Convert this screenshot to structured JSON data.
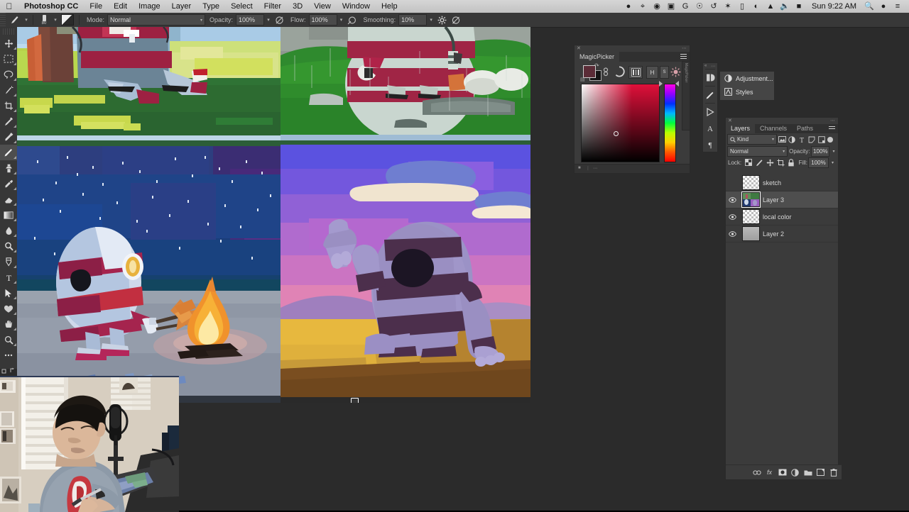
{
  "menubar": {
    "apple_icon": "apple-icon",
    "app_name": "Photoshop CC",
    "items": [
      "File",
      "Edit",
      "Image",
      "Layer",
      "Type",
      "Select",
      "Filter",
      "3D",
      "View",
      "Window",
      "Help"
    ],
    "status_icons": [
      "dropbox-icon",
      "trello-icon",
      "app-icon",
      "screenshot-icon",
      "grammarly-icon",
      "clock-circle-icon",
      "time-machine-icon",
      "bluetooth-icon",
      "airplay-icon",
      "wifi-icon",
      "eject-icon",
      "volume-icon",
      "input-source-icon"
    ],
    "clock": "Sun 9:22 AM",
    "search_icon": "search-icon",
    "siri_icon": "siri-icon",
    "notification_icon": "notification-center-icon"
  },
  "options_bar": {
    "tool_icon": "brush-tool-icon",
    "tool_caret": "▾",
    "brush_size": "80",
    "brush_preset_caret": "▾",
    "brush_panel_icon": "brush-panel-icon",
    "mode_label": "Mode:",
    "mode_value": "Normal",
    "opacity_label": "Opacity:",
    "opacity_value": "100%",
    "opacity_pressure_icon": "pressure-opacity-icon",
    "flow_label": "Flow:",
    "flow_value": "100%",
    "airbrush_icon": "airbrush-icon",
    "smoothing_label": "Smoothing:",
    "smoothing_value": "10%",
    "smoothing_gear_icon": "gear-icon",
    "symmetry_icon": "symmetry-icon",
    "caret": "▾"
  },
  "toolbar": {
    "tools": [
      {
        "name": "move-tool",
        "icon": "move-icon"
      },
      {
        "name": "rectangular-marquee-tool",
        "icon": "marquee-icon"
      },
      {
        "name": "lasso-tool",
        "icon": "lasso-icon"
      },
      {
        "name": "quick-selection-tool",
        "icon": "magic-wand-icon"
      },
      {
        "name": "crop-tool",
        "icon": "crop-icon"
      },
      {
        "name": "eyedropper-tool",
        "icon": "eyedropper-icon"
      },
      {
        "name": "spot-healing-brush-tool",
        "icon": "healing-brush-icon"
      },
      {
        "name": "brush-tool",
        "icon": "brush-icon",
        "selected": true
      },
      {
        "name": "clone-stamp-tool",
        "icon": "clone-stamp-icon"
      },
      {
        "name": "history-brush-tool",
        "icon": "history-brush-icon"
      },
      {
        "name": "eraser-tool",
        "icon": "eraser-icon"
      },
      {
        "name": "gradient-tool",
        "icon": "gradient-icon"
      },
      {
        "name": "blur-tool",
        "icon": "blur-icon"
      },
      {
        "name": "dodge-tool",
        "icon": "dodge-icon"
      },
      {
        "name": "pen-tool",
        "icon": "pen-icon"
      },
      {
        "name": "type-tool",
        "icon": "type-icon"
      },
      {
        "name": "path-selection-tool",
        "icon": "path-arrow-icon"
      },
      {
        "name": "shape-tool",
        "icon": "custom-shape-icon"
      },
      {
        "name": "hand-tool",
        "icon": "hand-icon"
      },
      {
        "name": "zoom-tool",
        "icon": "magnifier-icon"
      },
      {
        "name": "edit-toolbar-button",
        "icon": "ellipsis-icon"
      }
    ],
    "foreground_color": "#5b2c37",
    "background_color": "#151515",
    "quick_mask_icon": "quick-mask-icon",
    "screen_mode_icon": "screen-mode-icon"
  },
  "magicpicker": {
    "title": "MagicPicker",
    "close_icon": "close-icon",
    "menu_icon": "panel-menu-icon",
    "foreground_color": "#5b2c37",
    "background_color": "#141414",
    "buttons": [
      {
        "name": "link-icon",
        "label": ""
      },
      {
        "name": "color-wheel-icon",
        "label": ""
      },
      {
        "name": "color-bars-icon",
        "label": ""
      },
      {
        "name": "hue-mode-button",
        "label": "H"
      },
      {
        "name": "saturation-mode-button",
        "label": "S"
      },
      {
        "name": "brightness-icon",
        "label": ""
      }
    ],
    "side_tab_label": "MagicPicker",
    "marker_label": "color-marker"
  },
  "dockstrip": {
    "items": [
      {
        "name": "history-panel-icon",
        "glyph": "⧉"
      },
      {
        "name": "brush-settings-icon",
        "glyph": "✎"
      },
      {
        "name": "timeline-panel-icon",
        "glyph": "▶"
      },
      {
        "name": "character-panel-icon",
        "glyph": "A"
      },
      {
        "name": "paragraph-panel-icon",
        "glyph": "¶"
      }
    ]
  },
  "adjustments_flyout": {
    "items": [
      {
        "label": "Adjustment...",
        "icon": "adjustment-icon"
      },
      {
        "label": "Styles",
        "icon": "styles-icon"
      }
    ]
  },
  "layers_panel": {
    "close_icon": "close-icon",
    "menu_icon": "panel-menu-icon",
    "tabs": [
      {
        "label": "Layers",
        "active": true
      },
      {
        "label": "Channels",
        "active": false
      },
      {
        "label": "Paths",
        "active": false
      }
    ],
    "filter": {
      "search_icon": "search-icon",
      "kind_label": "Kind",
      "caret": "▾",
      "type_filters": [
        "pixel-filter-icon",
        "adjustment-filter-icon",
        "type-filter-icon",
        "shape-filter-icon",
        "smart-object-filter-icon"
      ],
      "toggle": "filter-toggle"
    },
    "blend_mode": "Normal",
    "opacity_label": "Opacity:",
    "opacity_value": "100%",
    "lock_label": "Lock:",
    "lock_icons": [
      "lock-transparent-icon",
      "lock-image-icon",
      "lock-position-icon",
      "lock-artboard-icon",
      "lock-all-icon"
    ],
    "fill_label": "Fill:",
    "fill_value": "100%",
    "caret": "▾",
    "layers": [
      {
        "name": "sketch",
        "visible": false,
        "selected": false,
        "thumb": "checker"
      },
      {
        "name": "Layer 3",
        "visible": true,
        "selected": true,
        "thumb": "art"
      },
      {
        "name": "local color",
        "visible": true,
        "selected": false,
        "thumb": "checker"
      },
      {
        "name": "Layer 2",
        "visible": true,
        "selected": false,
        "thumb": "gray"
      }
    ],
    "footer_icons": [
      {
        "name": "link-layers-icon",
        "glyph": "∞"
      },
      {
        "name": "layer-style-icon",
        "glyph": "fx"
      },
      {
        "name": "layer-mask-icon",
        "glyph": "◼"
      },
      {
        "name": "new-adjustment-layer-icon",
        "glyph": "◑"
      },
      {
        "name": "new-group-icon",
        "glyph": "▬"
      },
      {
        "name": "new-layer-icon",
        "glyph": "▣"
      },
      {
        "name": "delete-layer-icon",
        "glyph": "🗑"
      }
    ]
  },
  "canvas": {
    "document_name": "concept-art-canvas",
    "quadrants": [
      {
        "name": "scene-daytime-tree",
        "description": "Striped egg character beside a tree on green grass, blue sky"
      },
      {
        "name": "scene-rainy-meadow",
        "description": "Striped egg character with umbrella in rain on green meadow"
      },
      {
        "name": "scene-night-campfire",
        "description": "Striped egg character roasting marshmallow at campfire under starry night sky"
      },
      {
        "name": "scene-desert-sunset",
        "description": "Purple striped character holding ice cream in desert at sunset"
      }
    ],
    "brush_cursor": "brush-cursor"
  },
  "webcam": {
    "name": "webcam-overlay",
    "description": "Artist drawing on a pen display tablet with a microphone beside him"
  }
}
